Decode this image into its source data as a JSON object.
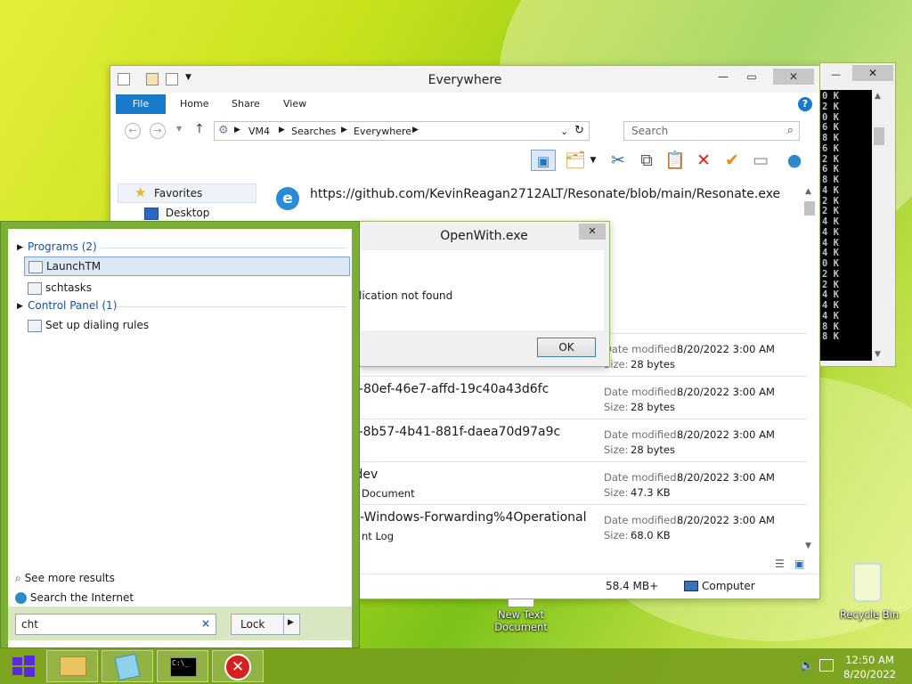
{
  "explorer": {
    "title": "Everywhere",
    "tabs": [
      "File",
      "Home",
      "Share",
      "View"
    ],
    "breadcrumb": [
      "VM4",
      "Searches",
      "Everywhere"
    ],
    "search_placeholder": "Search",
    "nav_favorites": "Favorites",
    "nav_desktop": "Desktop",
    "url_result": "https://github.com/KevinReagan2712ALT/Resonate/blob/main/Resonate.exe",
    "rows": [
      {
        "name": "",
        "sub": "",
        "modified_label": "Date modified:",
        "modified": "8/20/2022 3:00 AM",
        "size_label": "Size:",
        "size": "28 bytes"
      },
      {
        "name": "2-80ef-46e7-affd-19c40a43d6fc",
        "sub": "",
        "modified_label": "Date modified:",
        "modified": "8/20/2022 3:00 AM",
        "size_label": "Size:",
        "size": "28 bytes"
      },
      {
        "name": "a-8b57-4b41-881f-daea70d97a9c",
        "sub": "",
        "modified_label": "Date modified:",
        "modified": "8/20/2022 3:00 AM",
        "size_label": "Size:",
        "size": "28 bytes"
      },
      {
        "name": ".dev",
        "sub": "Document",
        "modified_label": "Date modified:",
        "modified": "8/20/2022 3:00 AM",
        "size_label": "Size:",
        "size": "47.3 KB"
      },
      {
        "name": "ft-Windows-Forwarding%4Operational",
        "sub": "nt Log",
        "modified_label": "Date modified:",
        "modified": "8/20/2022 3:00 AM",
        "size_label": "Size:",
        "size": "68.0 KB"
      }
    ],
    "status_size": "58.4 MB+",
    "status_location": "Computer"
  },
  "openwith": {
    "title": "OpenWith.exe",
    "message": "lication not found",
    "ok_label": "OK"
  },
  "console": {
    "lines": [
      "0 K",
      "2 K",
      "0 K",
      "6 K",
      "8 K",
      "6 K",
      "2 K",
      "6 K",
      "8 K",
      "4 K",
      "2 K",
      "2 K",
      "4 K",
      "4 K",
      "4 K",
      "4 K",
      "0 K",
      "2 K",
      "2 K",
      "4 K",
      "4 K",
      "4 K",
      "8 K",
      "8 K"
    ]
  },
  "start": {
    "programs_header": "Programs (2)",
    "programs": [
      "LaunchTM",
      "schtasks"
    ],
    "control_header": "Control Panel (1)",
    "control_items": [
      "Set up dialing rules"
    ],
    "see_more": "See more results",
    "search_internet": "Search the Internet",
    "query": "cht",
    "clear_glyph": "×",
    "power_label": "Lock"
  },
  "desktop_icons": {
    "new_text_doc": "New Text Document",
    "recycle_bin": "Recycle Bin"
  },
  "taskbar": {
    "time": "12:50 AM",
    "date": "8/20/2022"
  },
  "colors": {
    "accent": "#1979ca",
    "taskbar": "#769e1c",
    "start_frame": "#7bae34"
  }
}
